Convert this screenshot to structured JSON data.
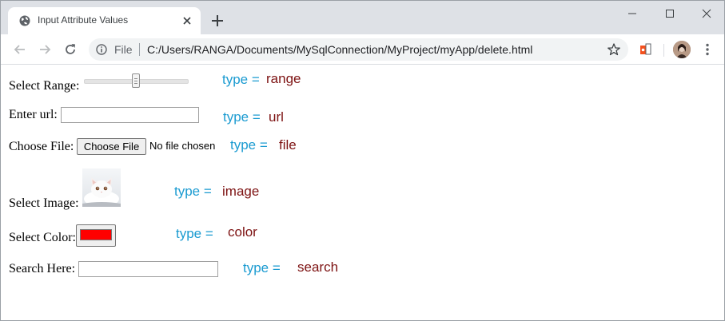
{
  "browser": {
    "tab_title": "Input Attribute Values",
    "scheme_label": "File",
    "url": "C:/Users/RANGA/Documents/MySqlConnection/MyProject/myApp/delete.html",
    "icons": [
      "globe-icon",
      "close-icon",
      "plus-icon",
      "minimize-icon",
      "maximize-icon",
      "window-close-icon",
      "back-icon",
      "forward-icon",
      "reload-icon",
      "info-icon",
      "star-icon",
      "extension-icon",
      "avatar",
      "menu-icon"
    ]
  },
  "form": {
    "range": {
      "label": "Select Range:",
      "type_key": "type =",
      "type_value": "range",
      "value_fraction": 0.5
    },
    "url": {
      "label": "Enter url:",
      "type_key": "type =",
      "type_value": "url",
      "value": ""
    },
    "file": {
      "label": "Choose File:",
      "button_label": "Choose File",
      "status": "No file chosen",
      "type_key": "type =",
      "type_value": "file"
    },
    "image": {
      "label": "Select Image:",
      "type_key": "type =",
      "type_value": "image"
    },
    "color": {
      "label": "Select Color:",
      "value": "#ff0000",
      "type_key": "type =",
      "type_value": "color"
    },
    "search": {
      "label": "Search Here:",
      "value": "",
      "type_key": "type =",
      "type_value": "search"
    }
  },
  "colors": {
    "type_key": "#1b9bd1",
    "type_value": "#7d1212",
    "tabstrip": "#dee1e6",
    "omnibox": "#f1f3f4"
  }
}
